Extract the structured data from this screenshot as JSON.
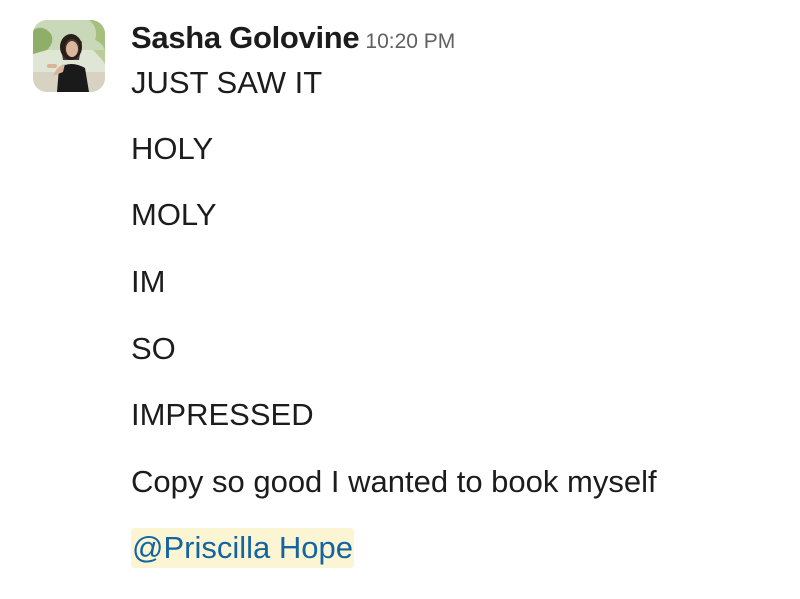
{
  "message": {
    "sender_name": "Sasha Golovine",
    "timestamp": "10:20 PM",
    "avatar_icon": "user-avatar-photo",
    "lines": [
      "JUST SAW IT",
      "HOLY",
      "MOLY",
      "IM",
      "SO",
      "IMPRESSED",
      "Copy so good I wanted to book myself"
    ],
    "mention": "@Priscilla Hope"
  },
  "colors": {
    "text": "#1d1c1d",
    "timestamp": "#616061",
    "mention_text": "#1264a3",
    "mention_background": "#fcf5d3"
  }
}
